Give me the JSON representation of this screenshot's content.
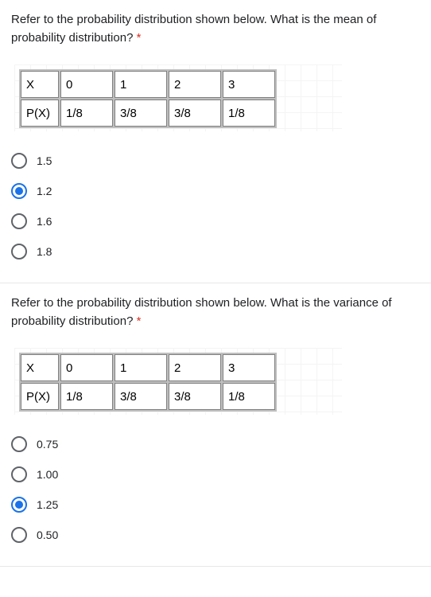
{
  "questions": [
    {
      "text": "Refer to the probability distribution shown below. What is the mean of probability distribution? ",
      "required": "*",
      "table": {
        "row1": [
          "X",
          "0",
          "1",
          "2",
          "3"
        ],
        "row2": [
          "P(X)",
          "1/8",
          "3/8",
          "3/8",
          "1/8"
        ]
      },
      "options": [
        {
          "label": "1.5",
          "selected": false
        },
        {
          "label": "1.2",
          "selected": true
        },
        {
          "label": "1.6",
          "selected": false
        },
        {
          "label": "1.8",
          "selected": false
        }
      ]
    },
    {
      "text": "Refer to the probability distribution shown below. What is the variance of probability distribution? ",
      "required": "*",
      "table": {
        "row1": [
          "X",
          "0",
          "1",
          "2",
          "3"
        ],
        "row2": [
          "P(X)",
          "1/8",
          "3/8",
          "3/8",
          "1/8"
        ]
      },
      "options": [
        {
          "label": "0.75",
          "selected": false
        },
        {
          "label": "1.00",
          "selected": false
        },
        {
          "label": "1.25",
          "selected": true
        },
        {
          "label": "0.50",
          "selected": false
        }
      ]
    }
  ]
}
